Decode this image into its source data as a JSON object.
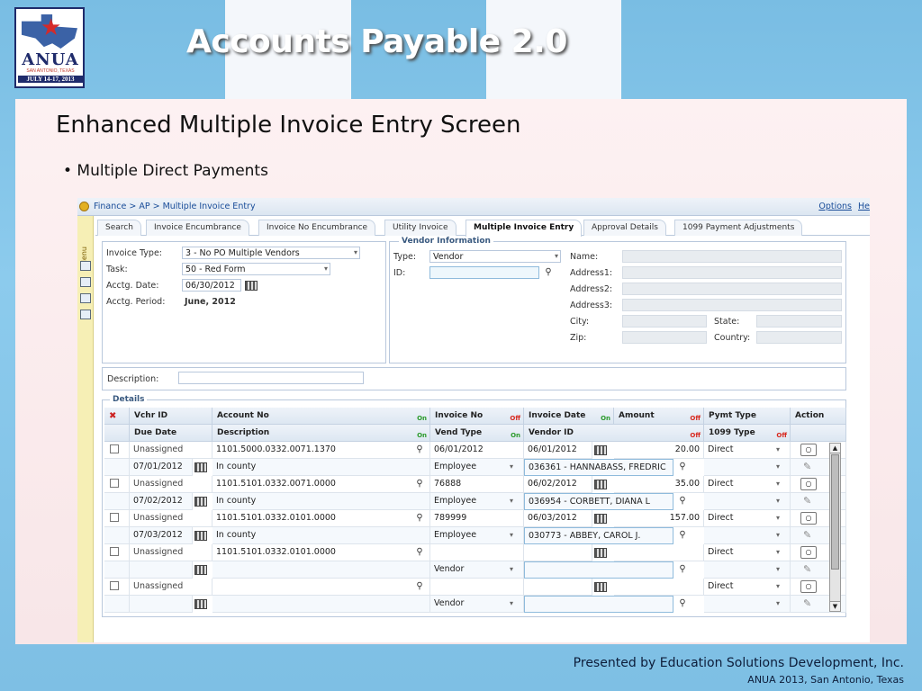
{
  "slide": {
    "title": "Accounts Payable 2.0",
    "heading": "Enhanced Multiple Invoice Entry Screen",
    "bullet": "• Multiple Direct Payments",
    "footer_line1": "Presented by Education Solutions Development, Inc.",
    "footer_line2": "ANUA 2013, San Antonio, Texas"
  },
  "logo": {
    "name": "ANUA",
    "subtitle": "SAN ANTONIO, TEXAS",
    "dates": "JULY 14-17, 2013"
  },
  "app": {
    "breadcrumb": "Finance > AP > Multiple Invoice Entry",
    "options_link": "Options",
    "help_link": "He",
    "menu_label": "Menu",
    "tabs": [
      {
        "label": "Search"
      },
      {
        "label": "Invoice Encumbrance"
      },
      {
        "label": "Invoice No Encumbrance"
      },
      {
        "label": "Utility Invoice"
      },
      {
        "label": "Multiple Invoice Entry",
        "active": true
      },
      {
        "label": "Approval Details"
      },
      {
        "label": "1099 Payment Adjustments"
      }
    ],
    "left_form": {
      "invoice_type_label": "Invoice Type:",
      "invoice_type_value": "3 - No PO Multiple Vendors",
      "task_label": "Task:",
      "task_value": "50 - Red Form",
      "acctg_date_label": "Acctg. Date:",
      "acctg_date_value": "06/30/2012",
      "acctg_period_label": "Acctg. Period:",
      "acctg_period_value": "June, 2012"
    },
    "vendor_info": {
      "legend": "Vendor Information",
      "type_label": "Type:",
      "type_value": "Vendor",
      "id_label": "ID:",
      "name_label": "Name:",
      "address1_label": "Address1:",
      "address2_label": "Address2:",
      "address3_label": "Address3:",
      "city_label": "City:",
      "state_label": "State:",
      "zip_label": "Zip:",
      "country_label": "Country:"
    },
    "description_label": "Description:",
    "details_legend": "Details",
    "grid_headers": {
      "row1": [
        "Vchr ID",
        "Account No",
        "Invoice No",
        "Invoice Date",
        "Amount",
        "Pymt Type",
        "Action"
      ],
      "row2": [
        "Due Date",
        "Description",
        "Vend Type",
        "Vendor ID",
        "1099 Type"
      ],
      "on": "On",
      "off": "Off"
    },
    "grid_rows": [
      {
        "vchr": "Unassigned",
        "account": "1101.5000.0332.0071.1370",
        "invoice_no": "06/01/2012",
        "invoice_date": "06/01/2012",
        "amount": "20.00",
        "pymt_type": "Direct",
        "due_date": "07/01/2012",
        "desc": "In county",
        "vend_type": "Employee",
        "vendor_id": "036361 - HANNABASS, FREDRIC"
      },
      {
        "vchr": "Unassigned",
        "account": "1101.5101.0332.0071.0000",
        "invoice_no": "76888",
        "invoice_date": "06/02/2012",
        "amount": "35.00",
        "pymt_type": "Direct",
        "due_date": "07/02/2012",
        "desc": "In county",
        "vend_type": "Employee",
        "vendor_id": "036954 - CORBETT, DIANA L"
      },
      {
        "vchr": "Unassigned",
        "account": "1101.5101.0332.0101.0000",
        "invoice_no": "789999",
        "invoice_date": "06/03/2012",
        "amount": "157.00",
        "pymt_type": "Direct",
        "due_date": "07/03/2012",
        "desc": "In county",
        "vend_type": "Employee",
        "vendor_id": "030773 - ABBEY, CAROL J."
      },
      {
        "vchr": "Unassigned",
        "account": "1101.5101.0332.0101.0000",
        "invoice_no": "",
        "invoice_date": "",
        "amount": "",
        "pymt_type": "Direct",
        "due_date": "",
        "desc": "",
        "vend_type": "Vendor",
        "vendor_id": ""
      },
      {
        "vchr": "Unassigned",
        "account": "",
        "invoice_no": "",
        "invoice_date": "",
        "amount": "",
        "pymt_type": "Direct",
        "due_date": "",
        "desc": "",
        "vend_type": "Vendor",
        "vendor_id": ""
      }
    ]
  }
}
